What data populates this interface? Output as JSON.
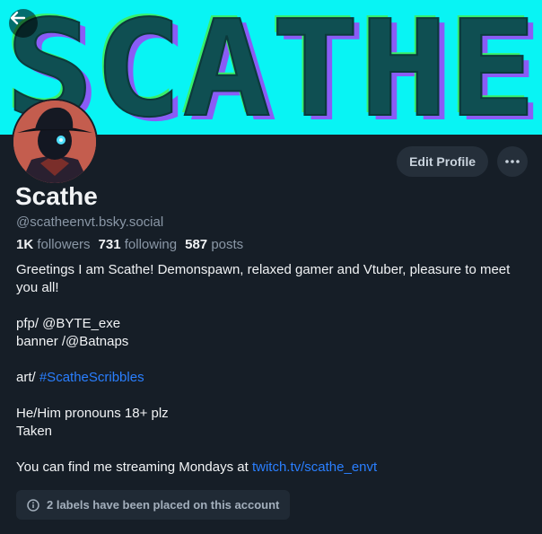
{
  "profile": {
    "name": "Scathe",
    "handle": "@scatheenvt.bsky.social",
    "banner_text": "SCATHE",
    "stats": {
      "followers_count": "1K",
      "followers_label": "followers",
      "following_count": "731",
      "following_label": "following",
      "posts_count": "587",
      "posts_label": "posts"
    }
  },
  "actions": {
    "edit_label": "Edit Profile"
  },
  "bio": {
    "line1": "Greetings I am Scathe! Demonspawn, relaxed gamer and Vtuber, pleasure to meet you all!",
    "pfp": "pfp/ @BYTE_exe",
    "banner": "banner /@Batnaps",
    "art_prefix": "art/ ",
    "art_tag": "#ScatheScribbles",
    "pronouns": "He/Him pronouns 18+ plz",
    "status": "Taken",
    "stream_prefix": "You can find me streaming Mondays at ",
    "stream_link": "twitch.tv/scathe_envt"
  },
  "labels_notice": "2 labels have been placed on this account",
  "colors": {
    "background": "#161e27",
    "banner": "#08f4f4",
    "link": "#2a7fff",
    "button": "#252f3a"
  }
}
